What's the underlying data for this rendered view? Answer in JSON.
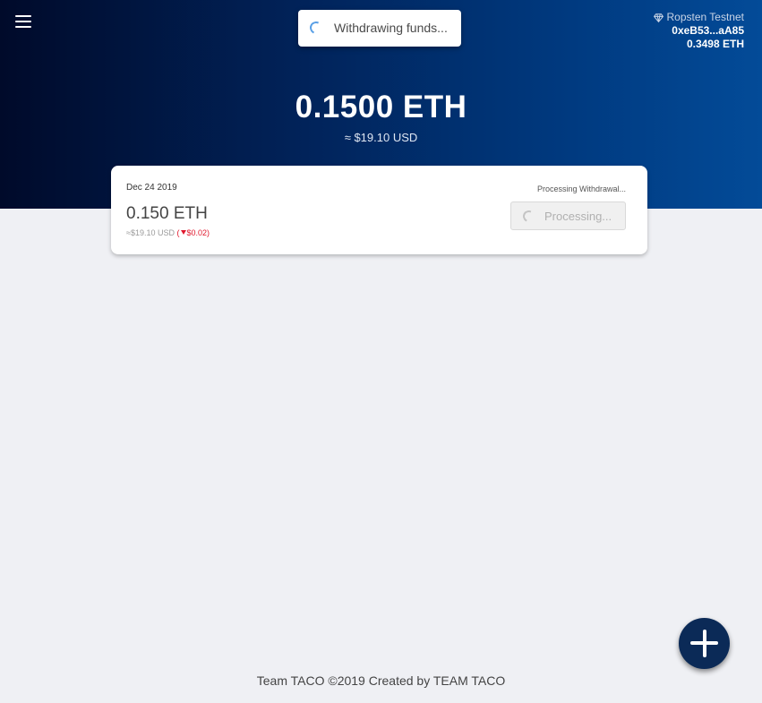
{
  "header": {
    "toast_text": "Withdrawing funds...",
    "network": {
      "name": "Ropsten Testnet",
      "address": "0xeB53...aA85",
      "balance": "0.3498 ETH"
    },
    "balance_eth": "0.1500 ETH",
    "balance_usd": "≈ $19.10 USD"
  },
  "card": {
    "date": "Dec 24 2019",
    "amount_eth": "0.150 ETH",
    "amount_usd": "≈$19.10 USD",
    "change": "$0.02",
    "status": "Processing Withdrawal...",
    "button_label": "Processing..."
  },
  "footer": {
    "text": "Team TACO ©2019 Created by TEAM TACO"
  },
  "icons": {
    "menu": "hamburger-icon",
    "network": "diamond-icon",
    "spinner": "spinner-icon",
    "change": "caret-down-icon",
    "add": "plus-icon"
  },
  "colors": {
    "header_dark": "#000a2a",
    "header_light": "#034b98",
    "background": "#eff0f4",
    "negative": "#e0182d",
    "fab": "#0b2a57"
  }
}
